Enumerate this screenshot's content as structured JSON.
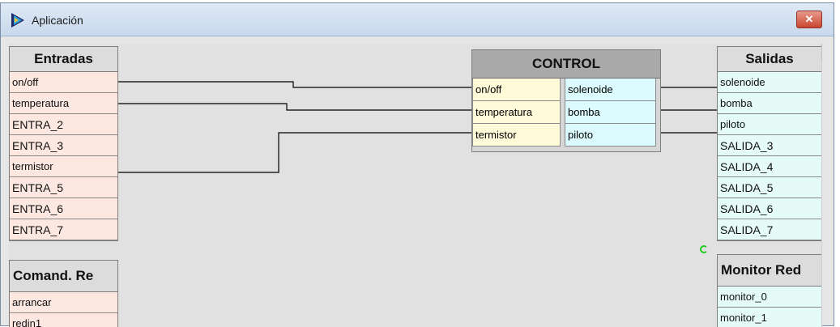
{
  "window": {
    "title": "Aplicación",
    "close_glyph": "✕"
  },
  "entradas": {
    "header": "Entradas",
    "items": [
      "on/off",
      "temperatura",
      "ENTRA_2",
      "ENTRA_3",
      "termistor",
      "ENTRA_5",
      "ENTRA_6",
      "ENTRA_7"
    ]
  },
  "comand": {
    "header": "Comand. Re",
    "items": [
      "arrancar",
      "redin1"
    ]
  },
  "control": {
    "header": "CONTROL",
    "inputs": [
      "on/off",
      "temperatura",
      "termistor"
    ],
    "outputs": [
      "solenoide",
      "bomba",
      "piloto"
    ]
  },
  "salidas": {
    "header": "Salidas",
    "items": [
      "solenoide",
      "bomba",
      "piloto",
      "SALIDA_3",
      "SALIDA_4",
      "SALIDA_5",
      "SALIDA_6",
      "SALIDA_7"
    ]
  },
  "monitor": {
    "header": "Monitor Red",
    "items": [
      "monitor_0",
      "monitor_1"
    ]
  },
  "icons": {
    "app": "app-icon",
    "close": "close-icon",
    "scroll_up": "scroll-up-icon"
  },
  "colors": {
    "input_rows": "#fce8e0",
    "output_rows": "#e4fbf8",
    "ctrl_in": "#fffbd8",
    "ctrl_out": "#dcfbff"
  }
}
